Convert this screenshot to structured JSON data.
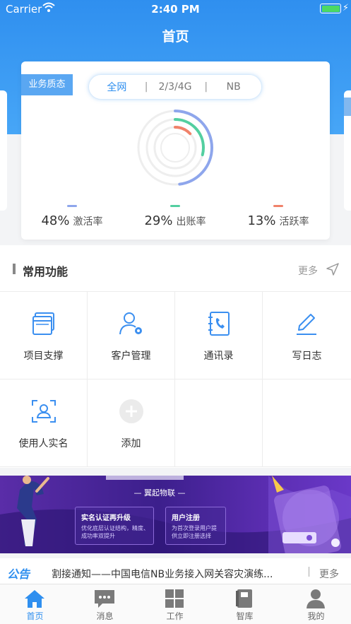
{
  "status_bar": {
    "carrier": "Carrier",
    "time": "2:40 PM"
  },
  "nav": {
    "title": "首页"
  },
  "summary_card": {
    "tag": "业务质态",
    "tabs": [
      "全网",
      "|",
      "2/3/4G",
      "|",
      "NB"
    ],
    "active_tab": "全网",
    "stats": [
      {
        "value": "48%",
        "label": "激活率",
        "color": "#8ea6ec"
      },
      {
        "value": "29%",
        "label": "出账率",
        "color": "#53cfa0"
      },
      {
        "value": "13%",
        "label": "活跃率",
        "color": "#f0826a"
      }
    ]
  },
  "functions": {
    "title": "常用功能",
    "more": "更多",
    "items": [
      {
        "label": "项目支撑",
        "icon": "window-stack-icon"
      },
      {
        "label": "客户管理",
        "icon": "user-gear-icon"
      },
      {
        "label": "通讯录",
        "icon": "contacts-phone-icon"
      },
      {
        "label": "写日志",
        "icon": "pencil-icon"
      },
      {
        "label": "使用人实名",
        "icon": "face-scan-icon"
      },
      {
        "label": "添加",
        "icon": "plus-circle-icon"
      }
    ]
  },
  "banner": {
    "subtitle": "— 翼起物联 —",
    "box1_title": "实名认证再升级",
    "box1_text": "优化底层认证结构，精度、成功率双提升",
    "box2_title": "用户注册",
    "box2_text": "为首次登录用户提供立即注册选择"
  },
  "notice": {
    "logo": "公告",
    "text": "割接通知——中国电信NB业务接入网关容灾演练...",
    "more": "更多"
  },
  "tabbar": {
    "items": [
      {
        "label": "首页",
        "active": true
      },
      {
        "label": "消息",
        "active": false
      },
      {
        "label": "工作",
        "active": false
      },
      {
        "label": "智库",
        "active": false
      },
      {
        "label": "我的",
        "active": false
      }
    ],
    "accent": "#2f8fef"
  }
}
